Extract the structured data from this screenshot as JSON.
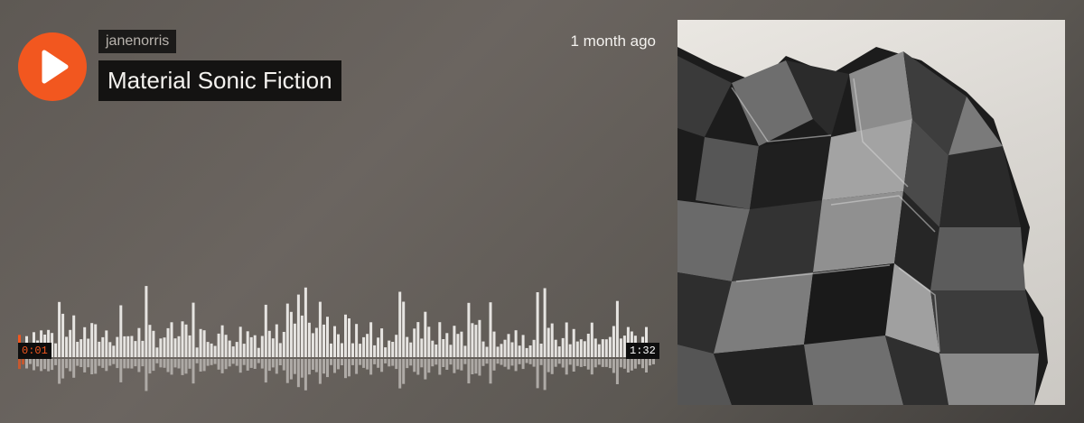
{
  "player": {
    "username": "janenorris",
    "title": "Material Sonic Fiction",
    "posted": "1 month ago",
    "play_icon": "play-icon",
    "accent_color": "#f2571f"
  },
  "waveform": {
    "current_time": "0:01",
    "duration": "1:32",
    "progress": 0.01
  },
  "artwork": {
    "description_icon": "artwork-image"
  }
}
